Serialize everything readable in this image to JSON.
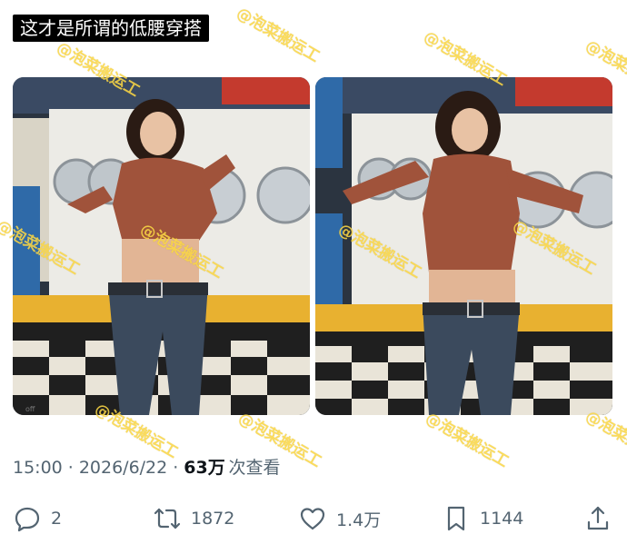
{
  "caption": "这才是所谓的低腰穿搭",
  "watermark": "@泡菜搬运工",
  "photo_small_text": "off",
  "meta": {
    "time": "15:00",
    "date": "2026/6/22",
    "views": "63万",
    "views_label": "次查看"
  },
  "actions": {
    "reply_count": "2",
    "retweet_count": "1872",
    "like_count": "1.4万",
    "bookmark_count": "1144"
  },
  "colors": {
    "muted_text": "#536471",
    "primary_text": "#0f1419",
    "watermark": "#ffda46"
  }
}
